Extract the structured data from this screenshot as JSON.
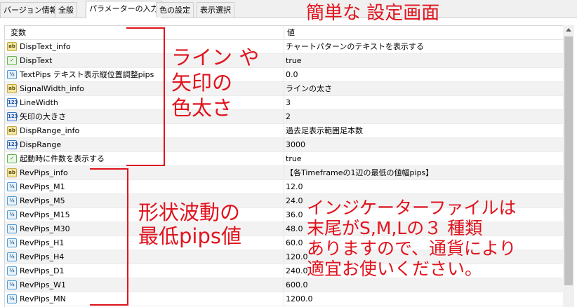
{
  "tabs": [
    {
      "label": "バージョン情報",
      "active": false
    },
    {
      "label": "全般",
      "active": false
    },
    {
      "label": "パラメーターの入力",
      "active": true
    },
    {
      "label": "色の設定",
      "active": false
    },
    {
      "label": "表示選択",
      "active": false
    }
  ],
  "page_title": "簡単な 設定画面",
  "grid": {
    "header": {
      "name": "変数",
      "value": "値"
    },
    "rows": [
      {
        "icon": "ab",
        "type": "string-icon",
        "name": "DispText_info",
        "value": "チャートパターンのテキストを表示する"
      },
      {
        "icon": "bool",
        "type": "bool-icon",
        "name": "DispText",
        "value": "true"
      },
      {
        "icon": "1/2",
        "type": "double-icon",
        "name": "TextPips テキスト表示縦位置調整pips",
        "value": "0.0"
      },
      {
        "icon": "ab",
        "type": "string-icon",
        "name": "SignalWidth_info",
        "value": "ラインの太さ"
      },
      {
        "icon": "123",
        "type": "int-icon",
        "name": "LineWidth",
        "value": "3"
      },
      {
        "icon": "123",
        "type": "int-icon",
        "name": "矢印の大きさ",
        "value": "2"
      },
      {
        "icon": "ab",
        "type": "string-icon",
        "name": "DispRange_info",
        "value": "過去足表示範囲足本数"
      },
      {
        "icon": "123",
        "type": "int-icon",
        "name": "DispRange",
        "value": "3000"
      },
      {
        "icon": "bool",
        "type": "bool-icon",
        "name": "起動時に件数を表示する",
        "value": "true"
      },
      {
        "icon": "ab",
        "type": "string-icon",
        "name": "RevPips_info",
        "value": "【各Timeframeの1辺の最低の値幅pips】"
      },
      {
        "icon": "1/2",
        "type": "double-icon",
        "name": "RevPips_M1",
        "value": "12.0"
      },
      {
        "icon": "1/2",
        "type": "double-icon",
        "name": "RevPips_M5",
        "value": "24.0"
      },
      {
        "icon": "1/2",
        "type": "double-icon",
        "name": "RevPips_M15",
        "value": "36.0"
      },
      {
        "icon": "1/2",
        "type": "double-icon",
        "name": "RevPips_M30",
        "value": "48.0"
      },
      {
        "icon": "1/2",
        "type": "double-icon",
        "name": "RevPips_H1",
        "value": "60.0"
      },
      {
        "icon": "1/2",
        "type": "double-icon",
        "name": "RevPips_H4",
        "value": "120.0"
      },
      {
        "icon": "1/2",
        "type": "double-icon",
        "name": "RevPips_D1",
        "value": "240.0"
      },
      {
        "icon": "1/2",
        "type": "double-icon",
        "name": "RevPips_W1",
        "value": "600.0"
      },
      {
        "icon": "1/2",
        "type": "double-icon",
        "name": "RevPips_MN",
        "value": "1200.0"
      }
    ]
  },
  "annotations": {
    "note1": "ライン や\n矢印の\n色太さ",
    "note2": "形状波動の\n最低pips値",
    "note3": "インジケーターファイルは\n末尾がS,M,Lの３ 種類\nありますので、通貨により\n適宜お使いください。"
  },
  "colors": {
    "annotation": "#e0141e"
  }
}
